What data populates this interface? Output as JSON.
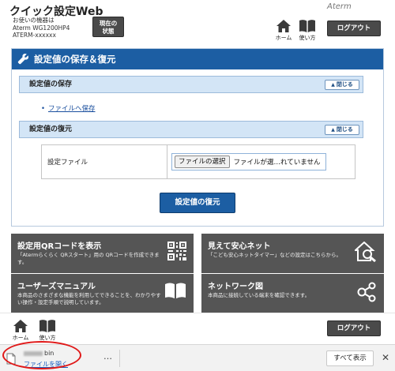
{
  "header": {
    "title": "クイック設定Web",
    "device_label": "お使いの機器は",
    "model": "Aterm WG1200HP4",
    "ssid": "ATERM-xxxxxx",
    "status_button_line1": "現在の",
    "status_button_line2": "状態",
    "brand": "Aterm",
    "home_label": "ホーム",
    "manual_label": "使い方",
    "logout_label": "ログアウト"
  },
  "panel": {
    "title": "設定値の保存＆復元",
    "save_section": {
      "title": "設定値の保存",
      "close_label": "閉じる",
      "link_label": "ファイルへ保存"
    },
    "restore_section": {
      "title": "設定値の復元",
      "close_label": "閉じる",
      "file_row_label": "設定ファイル",
      "choose_button": "ファイルの選択",
      "no_file_text": "ファイルが選…れていません"
    },
    "restore_button": "設定値の復元"
  },
  "tiles": [
    {
      "title": "設定用QRコードを表示",
      "desc": "「Atermらくらく QRスタート」用の QRコードを作成できます。",
      "icon": "qr-code-icon"
    },
    {
      "title": "見えて安心ネット",
      "desc": "「こども安心ネットタイマー」などの設定はこちらから。",
      "icon": "house-search-icon"
    },
    {
      "title": "ユーザーズマニュアル",
      "desc": "本商品のさまざまな機能を利用してできることを、わかりやすい操作・設定手順で説明しています。",
      "icon": "book-icon"
    },
    {
      "title": "ネットワーク図",
      "desc": "本商品に接続している端末を確認できます。",
      "icon": "network-icon"
    }
  ],
  "footer": {
    "home_label": "ホーム",
    "manual_label": "使い方",
    "logout_label": "ログアウト"
  },
  "download_bar": {
    "file_ext": "bin",
    "open_label": "ファイルを開く",
    "more_label": "…",
    "show_all_label": "すべて表示",
    "close_label": "✕"
  },
  "colors": {
    "panel_blue": "#1c5ea3",
    "section_bar": "#d3e5f6",
    "tile_gray": "#555555",
    "highlight_red": "#e01818"
  }
}
